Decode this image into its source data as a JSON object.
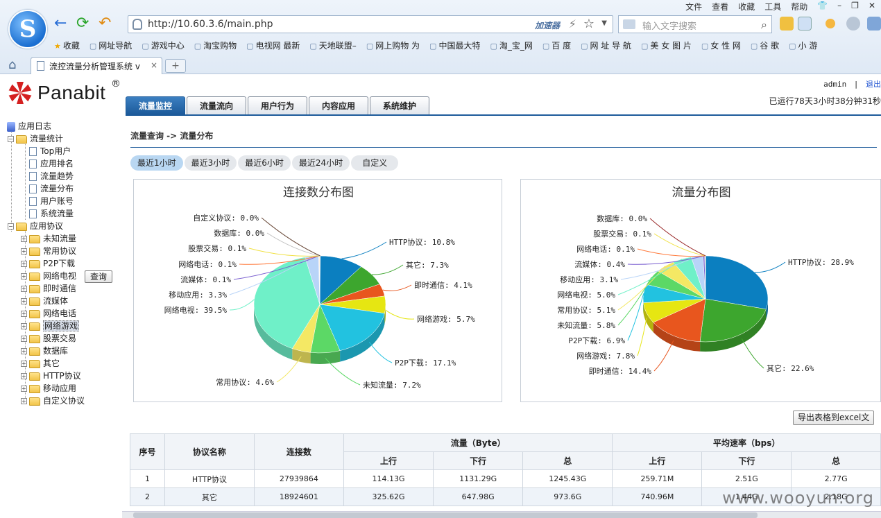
{
  "browser": {
    "menu": [
      "文件",
      "查看",
      "收藏",
      "工具",
      "帮助"
    ],
    "url": "http://10.60.3.6/main.php",
    "accelerator": "加速器",
    "search_placeholder": "输入文字搜索",
    "bookmarks": [
      "收藏",
      "网址导航",
      "游戏中心",
      "淘宝购物",
      "电视网 最新",
      "天地联盟–",
      "网上购物 为",
      "中国最大特",
      "淘_宝_网",
      "百 度",
      "网 址 导 航",
      "美 女 图 片",
      "女 性 网",
      "谷 歌",
      "小 游"
    ],
    "tab_title": "流控流量分析管理系统 v",
    "tab_close": "×",
    "new_tab": "+"
  },
  "header": {
    "brand": "Panabit",
    "reg": "®",
    "user": "admin",
    "separator": "|",
    "logout": "退出",
    "uptime": "已运行78天3小时38分钟31秒",
    "tabs": [
      "流量监控",
      "流量流向",
      "用户行为",
      "内容应用",
      "系统维护"
    ],
    "active_tab": 0
  },
  "sidebar": {
    "root": "应用日志",
    "group1": "流量统计",
    "group1_items": [
      "Top用户",
      "应用排名",
      "流量趋势",
      "流量分布",
      "用户账号",
      "系统流量"
    ],
    "group2": "应用协议",
    "group2_items": [
      "未知流量",
      "常用协议",
      "P2P下载",
      "网络电视",
      "即时通信",
      "流媒体",
      "网络电话",
      "网络游戏",
      "股票交易",
      "数据库",
      "其它",
      "HTTP协议",
      "移动应用",
      "自定义协议"
    ],
    "selected": "网络游戏",
    "query_button": "查询"
  },
  "content": {
    "breadcrumb": "流量查询 -> 流量分布",
    "time_tabs": [
      "最近1小时",
      "最近3小时",
      "最近6小时",
      "最近24小时",
      "自定义"
    ],
    "active_time_tab": 0,
    "export_button": "导出表格到excel文"
  },
  "chart_data": [
    {
      "type": "pie",
      "title": "连接数分布图",
      "slices": [
        {
          "label": "HTTP协议",
          "value": 10.8,
          "color": "#0b7fc0"
        },
        {
          "label": "其它",
          "value": 7.3,
          "color": "#3da62e"
        },
        {
          "label": "即时通信",
          "value": 4.1,
          "color": "#e8561e"
        },
        {
          "label": "网络游戏",
          "value": 5.7,
          "color": "#e6e612"
        },
        {
          "label": "P2P下载",
          "value": 17.1,
          "color": "#22c2e0"
        },
        {
          "label": "未知流量",
          "value": 7.2,
          "color": "#5cd866"
        },
        {
          "label": "常用协议",
          "value": 4.6,
          "color": "#f4e864"
        },
        {
          "label": "网络电视",
          "value": 39.5,
          "color": "#6ff0c8"
        },
        {
          "label": "移动应用",
          "value": 3.3,
          "color": "#b8d4f8"
        },
        {
          "label": "流媒体",
          "value": 0.1,
          "color": "#7a5fd0"
        },
        {
          "label": "网络电话",
          "value": 0.1,
          "color": "#ff7a3c"
        },
        {
          "label": "股票交易",
          "value": 0.1,
          "color": "#f0e040"
        },
        {
          "label": "数据库",
          "value": 0.0,
          "color": "#c0c0c0"
        },
        {
          "label": "自定义协议",
          "value": 0.0,
          "color": "#6a4a3a"
        }
      ]
    },
    {
      "type": "pie",
      "title": "流量分布图",
      "slices": [
        {
          "label": "HTTP协议",
          "value": 28.9,
          "color": "#0b7fc0"
        },
        {
          "label": "其它",
          "value": 22.6,
          "color": "#3da62e"
        },
        {
          "label": "即时通信",
          "value": 14.4,
          "color": "#e8561e"
        },
        {
          "label": "网络游戏",
          "value": 7.8,
          "color": "#e6e612"
        },
        {
          "label": "P2P下载",
          "value": 6.9,
          "color": "#22c2e0"
        },
        {
          "label": "未知流量",
          "value": 5.8,
          "color": "#5cd866"
        },
        {
          "label": "常用协议",
          "value": 5.1,
          "color": "#f4e864"
        },
        {
          "label": "网络电视",
          "value": 5.0,
          "color": "#6ff0c8"
        },
        {
          "label": "移动应用",
          "value": 3.1,
          "color": "#b8d4f8"
        },
        {
          "label": "流媒体",
          "value": 0.4,
          "color": "#7a5fd0"
        },
        {
          "label": "网络电话",
          "value": 0.1,
          "color": "#ff7a3c"
        },
        {
          "label": "股票交易",
          "value": 0.1,
          "color": "#f0e040"
        },
        {
          "label": "数据库",
          "value": 0.0,
          "color": "#9a2a2a"
        }
      ]
    }
  ],
  "table": {
    "headers": {
      "no": "序号",
      "name": "协议名称",
      "conn": "连接数",
      "traffic": "流量（Byte）",
      "rate": "平均速率（bps）",
      "up": "上行",
      "down": "下行",
      "total": "总"
    },
    "rows": [
      {
        "no": "1",
        "name": "HTTP协议",
        "conn": "27939864",
        "t_up": "114.13G",
        "t_down": "1131.29G",
        "t_total": "1245.43G",
        "r_up": "259.71M",
        "r_down": "2.51G",
        "r_total": "2.77G"
      },
      {
        "no": "2",
        "name": "其它",
        "conn": "18924601",
        "t_up": "325.62G",
        "t_down": "647.98G",
        "t_total": "973.6G",
        "r_up": "740.96M",
        "r_down": "1.44G",
        "r_total": "2.18G"
      }
    ]
  },
  "watermark": "www.wooyun.org"
}
